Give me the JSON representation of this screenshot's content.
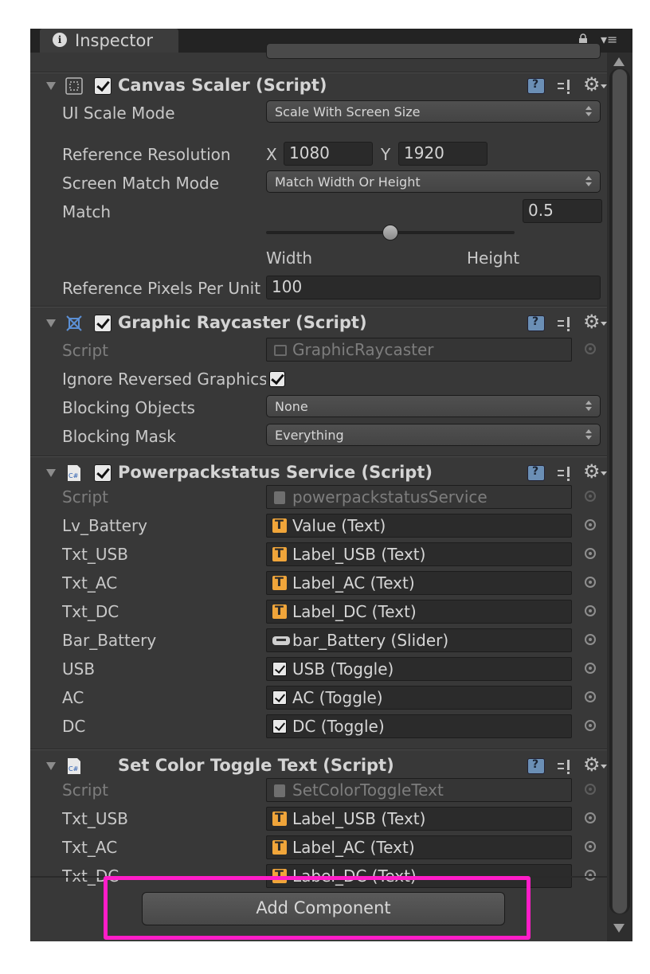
{
  "window": {
    "tab_title": "Inspector"
  },
  "canvas_scaler": {
    "title": "Canvas Scaler (Script)",
    "ui_scale_mode_label": "UI Scale Mode",
    "ui_scale_mode_value": "Scale With Screen Size",
    "ref_res_label": "Reference Resolution",
    "ref_x_label": "X",
    "ref_x_value": "1080",
    "ref_y_label": "Y",
    "ref_y_value": "1920",
    "match_mode_label": "Screen Match Mode",
    "match_mode_value": "Match Width Or Height",
    "match_label": "Match",
    "match_value": "0.5",
    "match_fraction": 0.5,
    "match_min_label": "Width",
    "match_max_label": "Height",
    "ref_ppu_label": "Reference Pixels Per Unit",
    "ref_ppu_value": "100"
  },
  "graphic_raycaster": {
    "title": "Graphic Raycaster (Script)",
    "script_label": "Script",
    "script_value": "GraphicRaycaster",
    "ignore_reversed_label": "Ignore Reversed Graphics",
    "ignore_reversed_checked": true,
    "blocking_objects_label": "Blocking Objects",
    "blocking_objects_value": "None",
    "blocking_mask_label": "Blocking Mask",
    "blocking_mask_value": "Everything"
  },
  "powerpack_service": {
    "title": "Powerpackstatus Service (Script)",
    "fields": [
      {
        "label": "Script",
        "value": "powerpackstatusService",
        "icon": "cs-script-icon"
      },
      {
        "label": "Lv_Battery",
        "value": "Value (Text)",
        "icon": "text-icon"
      },
      {
        "label": "Txt_USB",
        "value": "Label_USB (Text)",
        "icon": "text-icon"
      },
      {
        "label": "Txt_AC",
        "value": "Label_AC (Text)",
        "icon": "text-icon"
      },
      {
        "label": "Txt_DC",
        "value": "Label_DC (Text)",
        "icon": "text-icon"
      },
      {
        "label": "Bar_Battery",
        "value": "bar_Battery (Slider)",
        "icon": "slider-icon"
      },
      {
        "label": "USB",
        "value": "USB (Toggle)",
        "icon": "toggle-icon"
      },
      {
        "label": "AC",
        "value": "AC (Toggle)",
        "icon": "toggle-icon"
      },
      {
        "label": "DC",
        "value": "DC (Toggle)",
        "icon": "toggle-icon"
      }
    ]
  },
  "set_color_toggle": {
    "title": "Set Color Toggle Text (Script)",
    "fields": [
      {
        "label": "Script",
        "value": "SetColorToggleText",
        "icon": "cs-script-icon"
      },
      {
        "label": "Txt_USB",
        "value": "Label_USB (Text)",
        "icon": "text-icon"
      },
      {
        "label": "Txt_AC",
        "value": "Label_AC (Text)",
        "icon": "text-icon"
      },
      {
        "label": "Txt_DC",
        "value": "Label_DC (Text)",
        "icon": "text-icon"
      }
    ]
  },
  "add_component": {
    "label": "Add Component",
    "highlight_color": "#ff1dc8"
  },
  "colors": {
    "panel_bg": "#383838",
    "tab_bar": "#232323",
    "accent_check": "#e8e8e8"
  }
}
